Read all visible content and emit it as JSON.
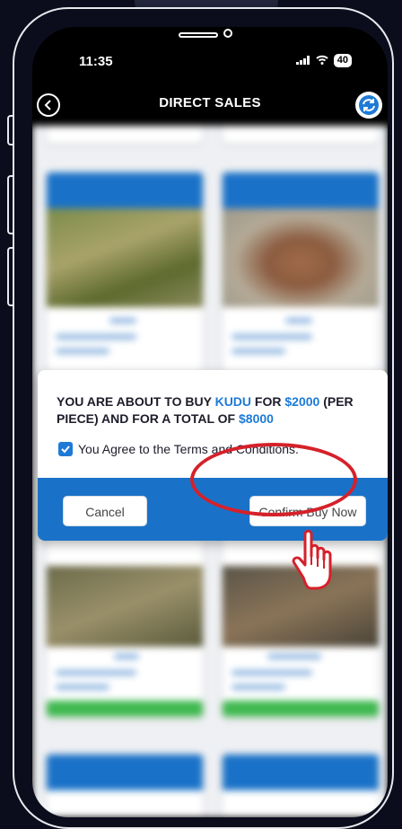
{
  "status_bar": {
    "time": "11:35",
    "battery": "40"
  },
  "header": {
    "title": "DIRECT SALES"
  },
  "modal": {
    "text_prefix": "YOU ARE ABOUT TO BUY ",
    "animal": "KUDU",
    "text_mid": " FOR ",
    "price": "$2000",
    "text_mid2": " (PER PIECE) AND FOR A TOTAL OF ",
    "total": "$8000",
    "agree_label": "You Agree to the Terms and Conditions.",
    "cancel_label": "Cancel",
    "confirm_label": "Confirm Buy Now"
  },
  "colors": {
    "accent": "#1a72c8",
    "highlight": "#d5212a",
    "price_text": "#1e7ad6"
  }
}
